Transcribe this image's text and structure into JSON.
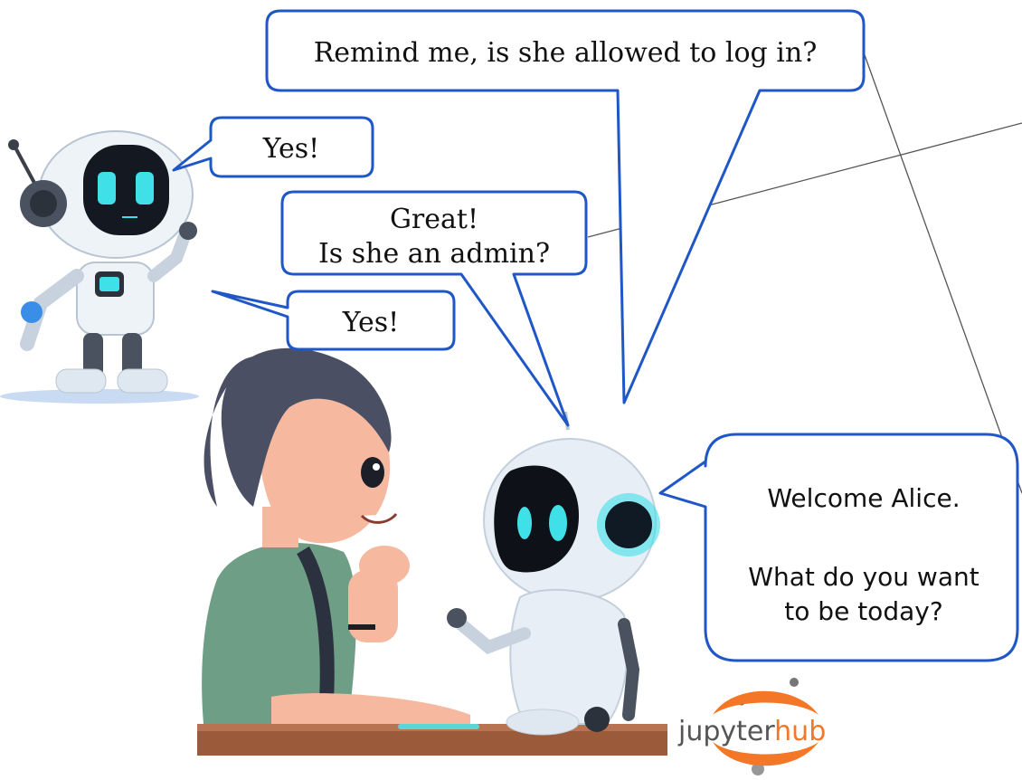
{
  "bubbles": {
    "remind": "Remind me, is she allowed to log in?",
    "yes_top": "Yes!",
    "great_line1": "Great!",
    "great_line2": "Is she an admin?",
    "yes_bottom": "Yes!",
    "welcome_line1": "Welcome Alice.",
    "welcome_line2": "What do you want",
    "welcome_line3": "to be today?"
  },
  "logo": {
    "word_main": "jupyter",
    "word_accent": "hub",
    "colors": {
      "main": "#555555",
      "accent": "#f37726"
    }
  },
  "colors": {
    "bubble_stroke": "#1f57c6",
    "robot_eye": "#3fe0e8",
    "robot_body": "#e8eef5",
    "hair": "#4a4f63",
    "shirt": "#6e9e86",
    "skin": "#f6b9a0",
    "desk": "#9b5a3a"
  }
}
